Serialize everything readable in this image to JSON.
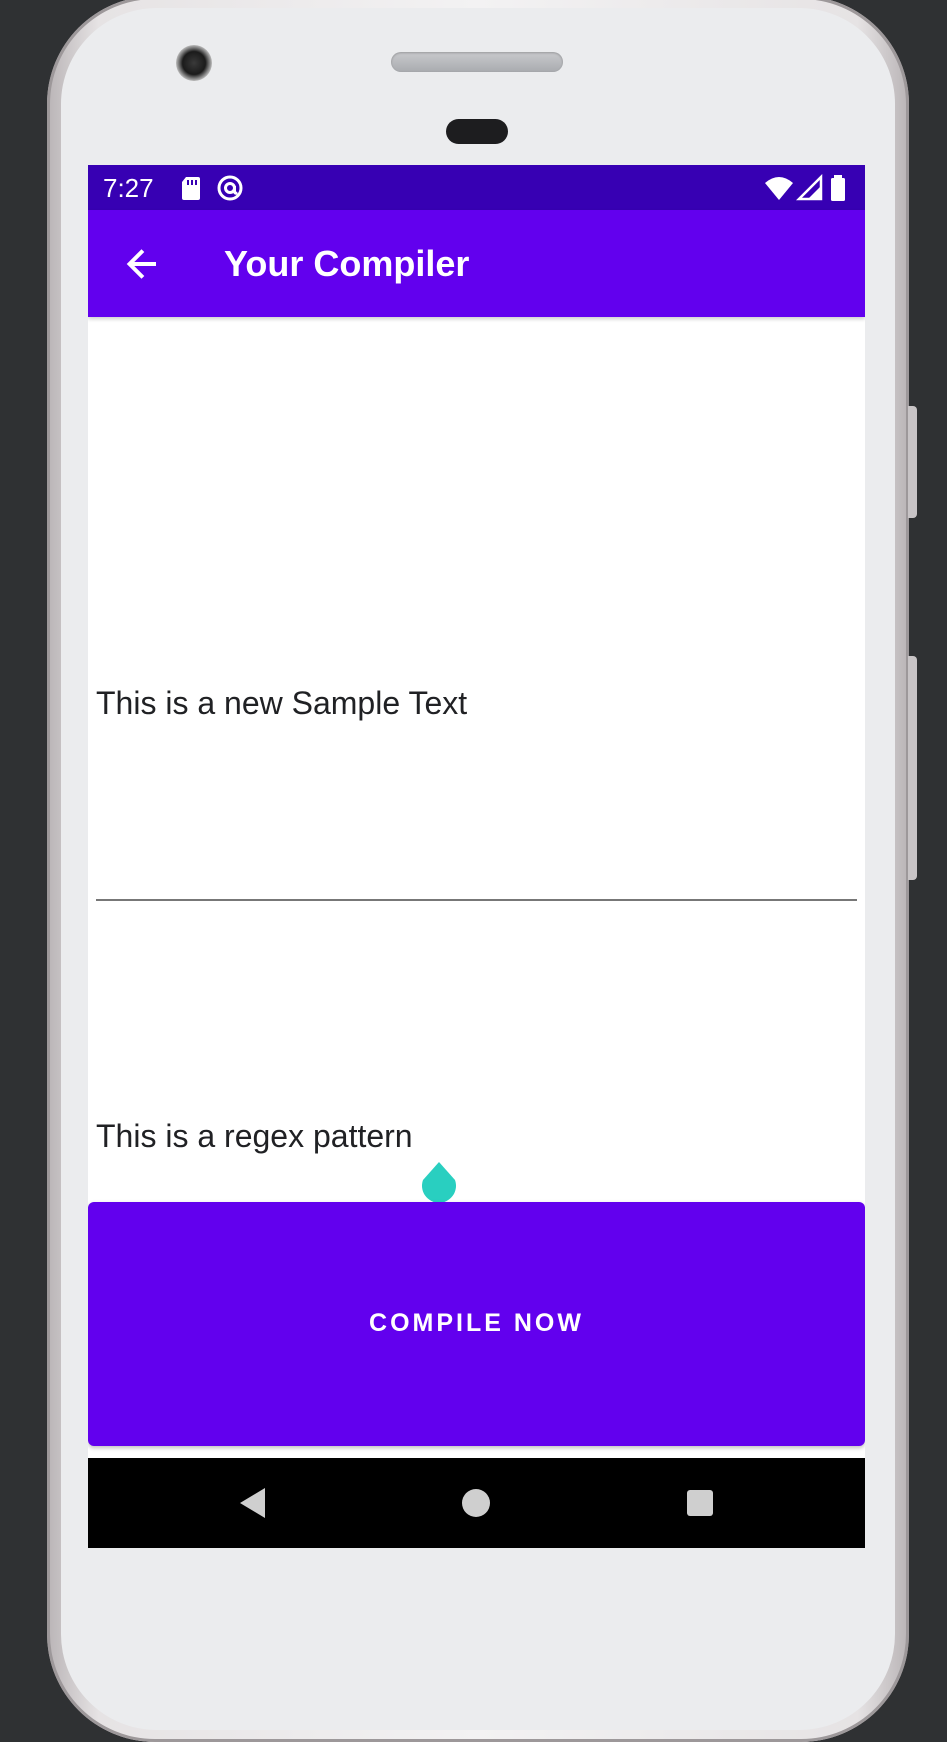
{
  "status_bar": {
    "time": "7:27",
    "left_icons": [
      "sd-card-icon",
      "at-sign-icon"
    ],
    "right_icons": [
      "wifi-icon",
      "signal-icon",
      "battery-icon"
    ]
  },
  "app_bar": {
    "title": "Your Compiler",
    "back_icon": "arrow-back-icon"
  },
  "sample_text_field": {
    "value": "This is a new Sample Text"
  },
  "regex_field": {
    "value": "This is a regex pattern"
  },
  "compile_button": {
    "label": "COMPILE NOW"
  },
  "navigation_bar": {
    "buttons": [
      "back-triangle-icon",
      "home-circle-icon",
      "recents-square-icon"
    ]
  },
  "colors": {
    "status_bar": "#3700b3",
    "primary": "#6200ee",
    "accent": "#29cfc0"
  }
}
